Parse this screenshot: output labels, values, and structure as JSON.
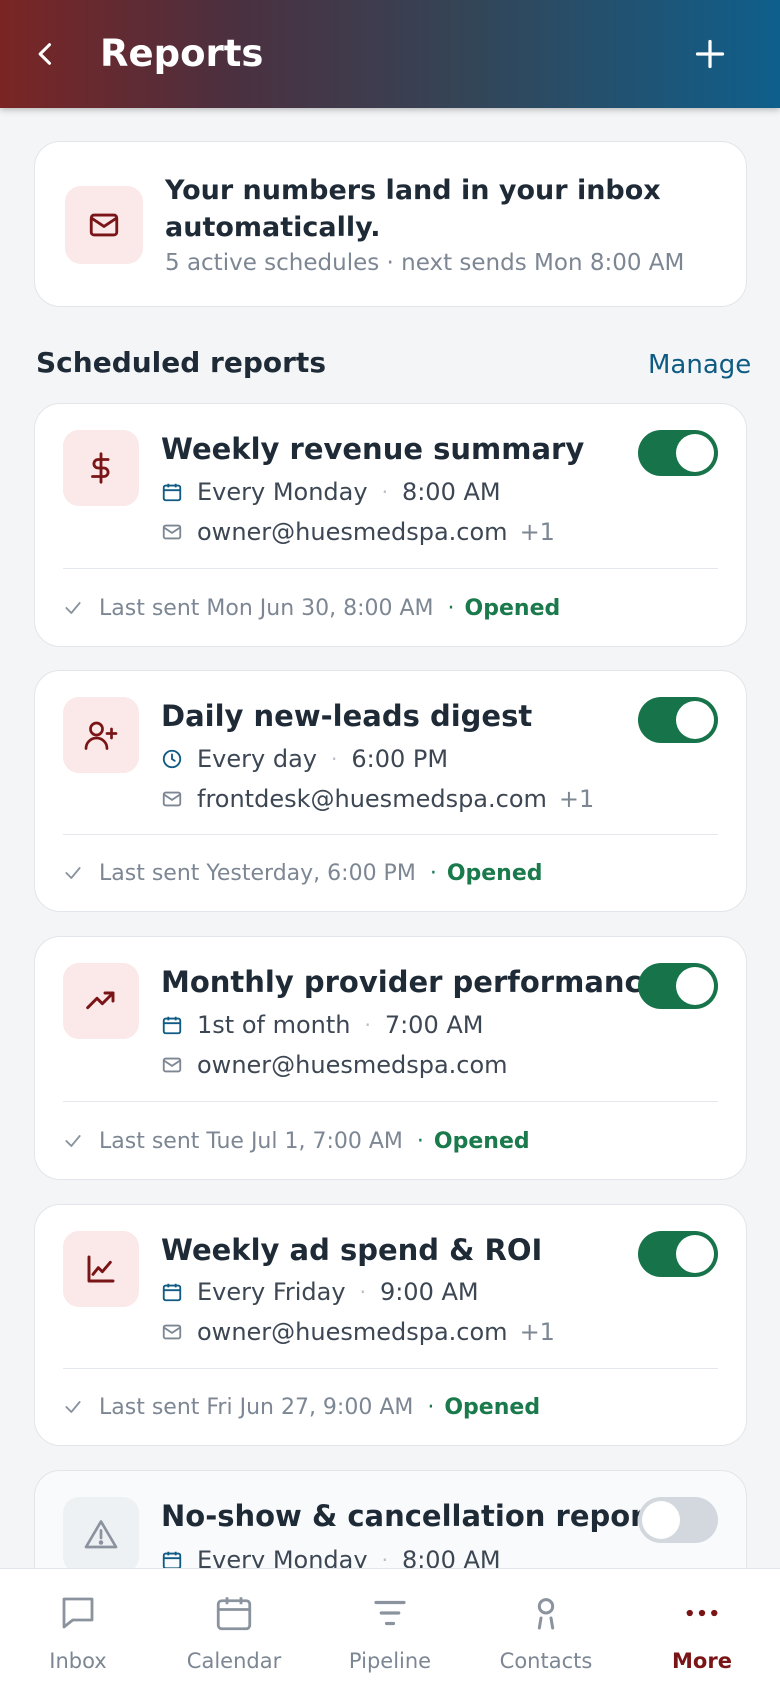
{
  "header": {
    "title": "Reports",
    "back_icon": "chevron-left-icon",
    "add_icon": "plus-icon"
  },
  "banner": {
    "icon": "mail-icon",
    "headline": "Your numbers land in your inbox automatically.",
    "subtitle": "5 active schedules · next sends Mon 8:00 AM"
  },
  "section": {
    "title": "Scheduled reports",
    "manage_label": "Manage"
  },
  "reports": [
    {
      "name": "Weekly revenue summary",
      "icon": "dollar-icon",
      "schedule_icon": "calendar-icon",
      "frequency": "Every Monday",
      "time": "8:00 AM",
      "recipient": "owner@huesmedspa.com",
      "extra_recipients": "+1",
      "last_sent": "Last sent Mon Jun 30, 8:00 AM",
      "status": "Opened",
      "enabled": true
    },
    {
      "name": "Daily new-leads digest",
      "icon": "user-plus-icon",
      "schedule_icon": "clock-icon",
      "frequency": "Every day",
      "time": "6:00 PM",
      "recipient": "frontdesk@huesmedspa.com",
      "extra_recipients": "+1",
      "last_sent": "Last sent Yesterday, 6:00 PM",
      "status": "Opened",
      "enabled": true
    },
    {
      "name": "Monthly provider performance",
      "icon": "trending-up-icon",
      "schedule_icon": "calendar-icon",
      "frequency": "1st of month",
      "time": "7:00 AM",
      "recipient": "owner@huesmedspa.com",
      "extra_recipients": "",
      "last_sent": "Last sent Tue Jul 1, 7:00 AM",
      "status": "Opened",
      "enabled": true
    },
    {
      "name": "Weekly ad spend & ROI",
      "icon": "line-chart-icon",
      "schedule_icon": "calendar-icon",
      "frequency": "Every Friday",
      "time": "9:00 AM",
      "recipient": "owner@huesmedspa.com",
      "extra_recipients": "+1",
      "last_sent": "Last sent Fri Jun 27, 9:00 AM",
      "status": "Opened",
      "enabled": true
    },
    {
      "name": "No-show & cancellation report",
      "icon": "warning-icon",
      "schedule_icon": "calendar-icon",
      "frequency": "Every Monday",
      "time": "8:00 AM",
      "enabled": false
    }
  ],
  "nav": [
    {
      "label": "Inbox",
      "icon": "chat-icon"
    },
    {
      "label": "Calendar",
      "icon": "calendar-icon"
    },
    {
      "label": "Pipeline",
      "icon": "filter-lines-icon"
    },
    {
      "label": "Contacts",
      "icon": "person-icon"
    },
    {
      "label": "More",
      "icon": "more-dots-icon",
      "active": true
    }
  ],
  "colors": {
    "accent_dark_red": "#7a1517",
    "status_green": "#1a7a4c",
    "toggle_on": "#17744a",
    "link_blue": "#0f5b84"
  }
}
